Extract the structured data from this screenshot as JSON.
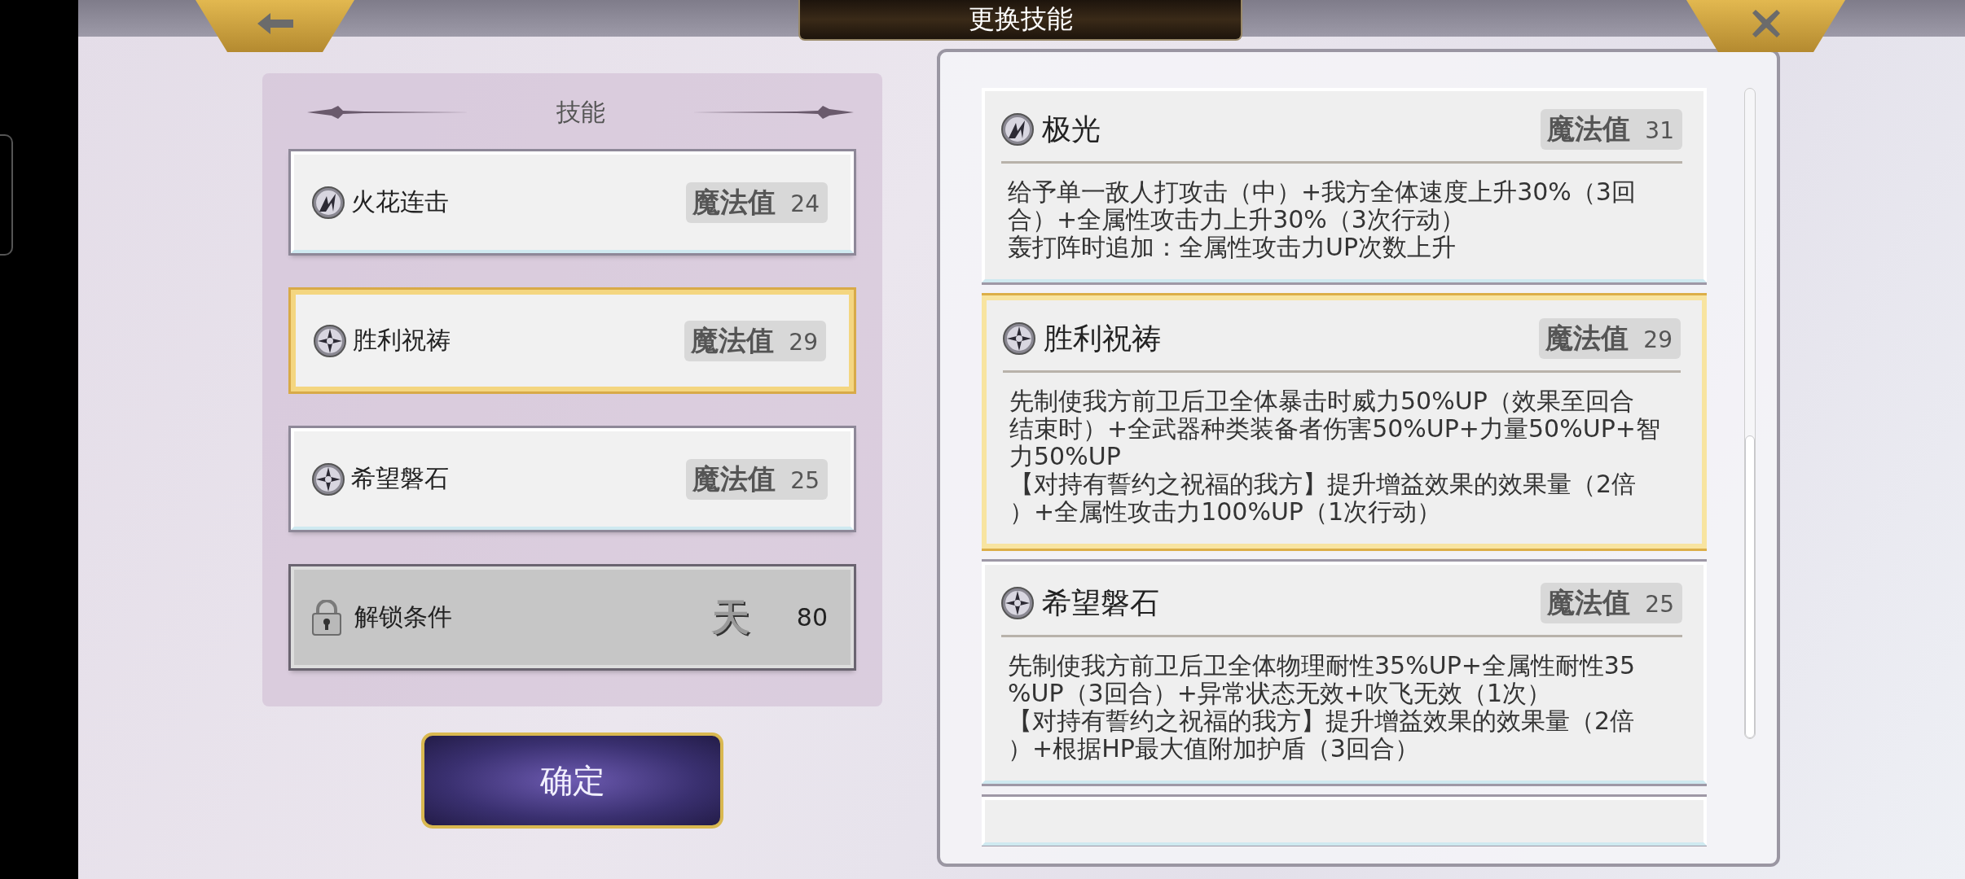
{
  "header": {
    "title": "更换技能"
  },
  "skill_slots": {
    "heading": "技能",
    "items": [
      {
        "kind": "attack",
        "name": "火花连击",
        "cost_label": "魔法值",
        "cost": "24",
        "selected": false
      },
      {
        "kind": "support",
        "name": "胜利祝祷",
        "cost_label": "魔法值",
        "cost": "29",
        "selected": true
      },
      {
        "kind": "support",
        "name": "希望磐石",
        "cost_label": "魔法值",
        "cost": "25",
        "selected": false
      },
      {
        "kind": "locked",
        "name": "解锁条件",
        "emblem": "天",
        "cost": "80",
        "selected": false
      }
    ]
  },
  "confirm_button": "确定",
  "skill_list": [
    {
      "kind": "attack",
      "name": "极光",
      "cost_label": "魔法值",
      "cost": "31",
      "selected": false,
      "description": [
        "给予单一敌人打攻击（中）+我方全体速度上升30%（3回",
        "合）+全属性攻击力上升30%（3次行动）",
        "轰打阵时追加：全属性攻击力UP次数上升"
      ]
    },
    {
      "kind": "support",
      "name": "胜利祝祷",
      "cost_label": "魔法值",
      "cost": "29",
      "selected": true,
      "description": [
        "先制使我方前卫后卫全体暴击时威力50%UP（效果至回合",
        "结束时）+全武器种类装备者伤害50%UP+力量50%UP+智",
        "力50%UP",
        "【对持有誓约之祝福的我方】提升增益效果的效果量（2倍",
        "）+全属性攻击力100%UP（1次行动）"
      ]
    },
    {
      "kind": "support",
      "name": "希望磐石",
      "cost_label": "魔法值",
      "cost": "25",
      "selected": false,
      "description": [
        "先制使我方前卫后卫全体物理耐性35%UP+全属性耐性35",
        "%UP（3回合）+异常状态无效+吹飞无效（1次）",
        "【对持有誓约之祝福的我方】提升增益效果的效果量（2倍",
        "）+根据HP最大值附加护盾（3回合）"
      ]
    }
  ]
}
